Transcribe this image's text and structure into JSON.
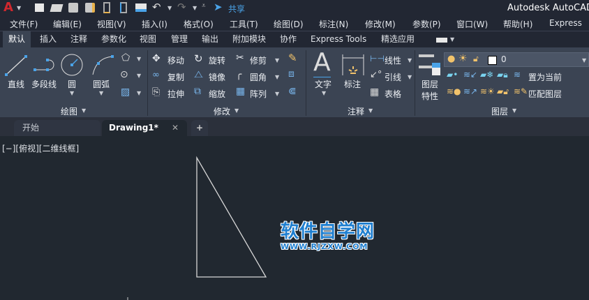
{
  "app_title": "Autodesk AutoCAD",
  "quick_access": {
    "share_label": "共享",
    "icons": [
      "app-menu",
      "new",
      "open",
      "save",
      "save-as",
      "open-web",
      "save-web",
      "plot",
      "undo",
      "redo",
      "customize",
      "share"
    ]
  },
  "menu": [
    "文件(F)",
    "编辑(E)",
    "视图(V)",
    "插入(I)",
    "格式(O)",
    "工具(T)",
    "绘图(D)",
    "标注(N)",
    "修改(M)",
    "参数(P)",
    "窗口(W)",
    "帮助(H)",
    "Express"
  ],
  "ribbon_tabs": [
    "默认",
    "插入",
    "注释",
    "参数化",
    "视图",
    "管理",
    "输出",
    "附加模块",
    "协作",
    "Express Tools",
    "精选应用"
  ],
  "active_tab": "默认",
  "panels": {
    "draw": {
      "title": "绘图",
      "line": "直线",
      "polyline": "多段线",
      "circle": "圆",
      "arc": "圆弧"
    },
    "modify": {
      "title": "修改",
      "move": "移动",
      "rotate": "旋转",
      "trim": "修剪",
      "copy": "复制",
      "mirror": "镜像",
      "fillet": "圆角",
      "stretch": "拉伸",
      "scale": "缩放",
      "array": "阵列"
    },
    "annotation": {
      "title": "注释",
      "text": "文字",
      "dimension": "标注",
      "linear": "线性",
      "leader": "引线",
      "table": "表格"
    },
    "layers": {
      "title": "图层",
      "properties_line1": "图层",
      "properties_line2": "特性",
      "current_layer": "0",
      "set_current": "置为当前",
      "match_layer": "匹配图层"
    }
  },
  "file_tabs": {
    "start": "开始",
    "drawing": "Drawing1*",
    "add": "+"
  },
  "viewport_label": "[−][俯视][二维线框]",
  "watermark": {
    "title": "软件自学网",
    "url": "WWW.RJZXW.COM"
  },
  "colors": {
    "accent": "#4aa3e8",
    "ribbon_bg": "#3b4453",
    "canvas_bg": "#212830"
  }
}
